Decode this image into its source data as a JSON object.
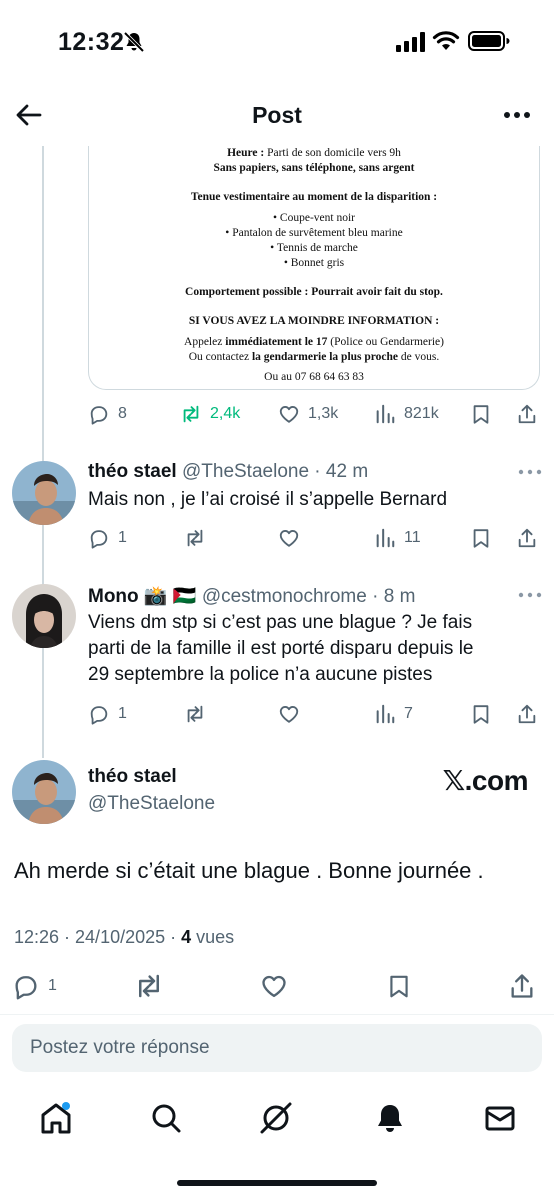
{
  "status_bar": {
    "time": "12:32"
  },
  "header": {
    "title": "Post"
  },
  "media_document": {
    "lines": [
      {
        "bold_prefix": "Heure :",
        "text": " Parti de son domicile vers 9h"
      },
      {
        "bold_prefix": "Sans papiers, sans téléphone, sans argent",
        "text": ""
      }
    ],
    "clothing_title": "Tenue vestimentaire au moment de la disparition :",
    "clothing_items": [
      "Coupe-vent noir",
      "Pantalon de survêtement bleu marine",
      "Tennis de marche",
      "Bonnet gris"
    ],
    "behavior_bold": "Comportement possible : Pourrait avoir fait du stop.",
    "info_title": "SI VOUS AVEZ LA MOINDRE INFORMATION :",
    "call_prefix": "Appelez ",
    "call_bold": "immédiatement le 17",
    "call_suffix": " (Police ou Gendarmerie)",
    "contact_prefix": "Ou contactez ",
    "contact_bold": "la gendarmerie la plus proche",
    "contact_suffix": " de vous.",
    "phone": "Ou au 07 68 64 63 83"
  },
  "original_actions": {
    "replies": "8",
    "reposts": "2,4k",
    "likes": "1,3k",
    "views": "821k"
  },
  "replies": [
    {
      "name": "théo stael",
      "handle": "@TheStaelone",
      "time": " · 42 m",
      "text": "Mais non , je l’ai croisé il s’appelle Bernard",
      "replies": "1",
      "views": "11"
    },
    {
      "name": "Mono 📸 🇵🇸",
      "handle": "@cestmonochrome",
      "time": " · 8 m",
      "text_lines": [
        "Viens dm stp si c’est pas une blague ? Je fais",
        "parti de la famille il est porté disparu depuis le",
        "29 septembre la police n’a aucune pistes"
      ],
      "replies": "1",
      "views": "7"
    }
  ],
  "main_tweet": {
    "name": "théo stael",
    "handle": "@TheStaelone",
    "watermark": "𝕏.com",
    "text": "Ah merde si c’était une blague . Bonne journée .",
    "timestamp": "12:26 · 24/10/2025 · ",
    "views_count": "4",
    "views_label": " vues",
    "replies": "1"
  },
  "reply_box": {
    "placeholder": "Postez votre réponse"
  },
  "colors": {
    "accent": "#1d9bf0",
    "repost_green": "#00ba7c",
    "muted": "#536471",
    "text": "#0f1419"
  }
}
